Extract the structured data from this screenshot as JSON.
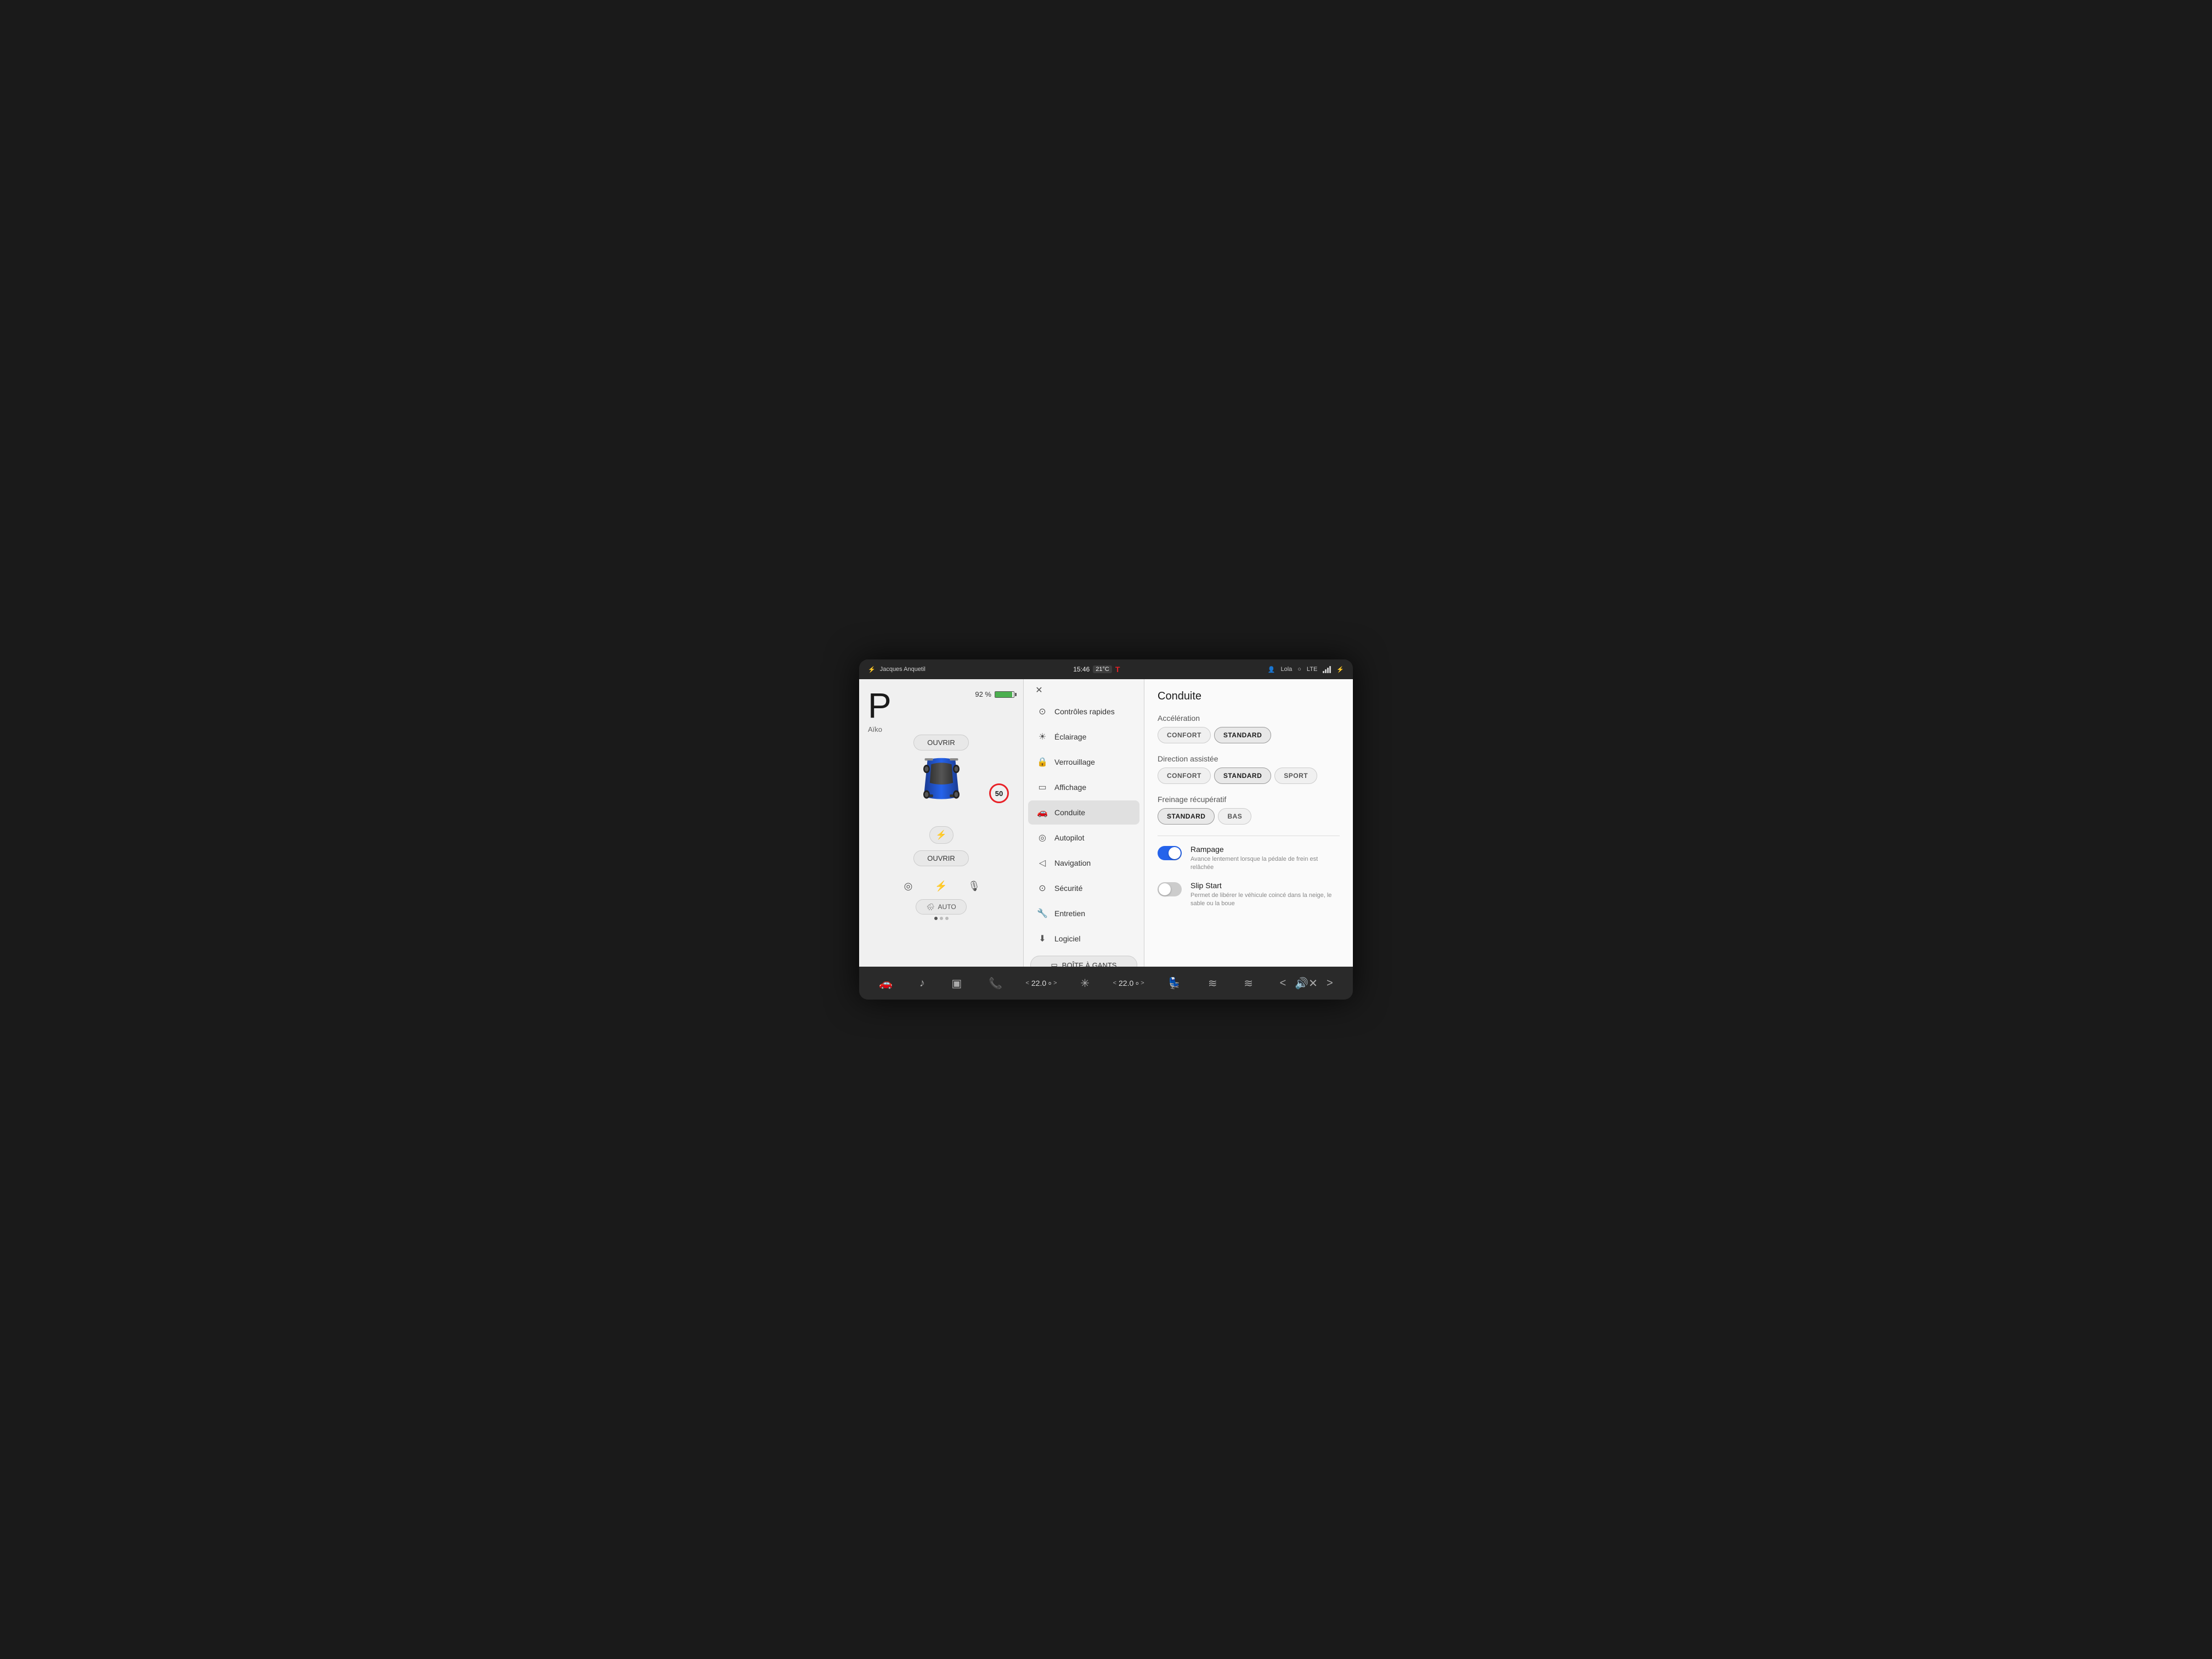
{
  "topbar": {
    "charging_icon": "⚡",
    "location": "Jacques Anquetil",
    "time": "15:46",
    "temperature": "21°C",
    "tesla_logo": "T",
    "user_name": "Lola",
    "lte": "LTE",
    "bluetooth": "⚡"
  },
  "left_panel": {
    "gear": "P",
    "battery_percent": "92 %",
    "car_name": "Aïko",
    "open_top_label": "OUVRIR",
    "speed_limit": "50",
    "charge_icon": "⚡",
    "open_bottom_label": "OUVRIR",
    "wiper_label": "AUTO"
  },
  "menu": {
    "close_icon": "✕",
    "items": [
      {
        "id": "controles",
        "icon": "⊙",
        "label": "Contrôles rapides"
      },
      {
        "id": "eclairage",
        "icon": "☀",
        "label": "Éclairage"
      },
      {
        "id": "verrouillage",
        "icon": "🔒",
        "label": "Verrouillage"
      },
      {
        "id": "affichage",
        "icon": "📺",
        "label": "Affichage"
      },
      {
        "id": "conduite",
        "icon": "🚗",
        "label": "Conduite",
        "active": true
      },
      {
        "id": "autopilot",
        "icon": "◎",
        "label": "Autopilot"
      },
      {
        "id": "navigation",
        "icon": "◁",
        "label": "Navigation"
      },
      {
        "id": "securite",
        "icon": "⊙",
        "label": "Sécurité"
      },
      {
        "id": "entretien",
        "icon": "🔧",
        "label": "Entretien"
      },
      {
        "id": "logiciel",
        "icon": "⬇",
        "label": "Logiciel"
      }
    ],
    "glove_box_label": "BOÎTE À GANTS"
  },
  "settings": {
    "title": "Conduite",
    "acceleration": {
      "label": "Accélération",
      "options": [
        {
          "id": "confort",
          "label": "CONFORT",
          "active": false
        },
        {
          "id": "standard",
          "label": "STANDARD",
          "active": true
        }
      ]
    },
    "direction": {
      "label": "Direction assistée",
      "options": [
        {
          "id": "confort",
          "label": "CONFORT",
          "active": false
        },
        {
          "id": "standard",
          "label": "STANDARD",
          "active": true
        },
        {
          "id": "sport",
          "label": "SPORT",
          "active": false
        }
      ]
    },
    "freinage": {
      "label": "Freinage récupératif",
      "options": [
        {
          "id": "standard",
          "label": "STANDARD",
          "active": true
        },
        {
          "id": "bas",
          "label": "BAS",
          "active": false
        }
      ]
    },
    "rampage": {
      "title": "Rampage",
      "desc": "Avance lentement lorsque la pédale de frein est relâchée",
      "enabled": true
    },
    "slip_start": {
      "title": "Slip Start",
      "desc": "Permet de libérer le véhicule coincé dans la neige, le sable ou la boue",
      "enabled": false
    }
  },
  "bottom_bar": {
    "temp_left": "22.0",
    "temp_right": "22.0",
    "volume_icon": "🔊",
    "mute_icon": "✕"
  }
}
